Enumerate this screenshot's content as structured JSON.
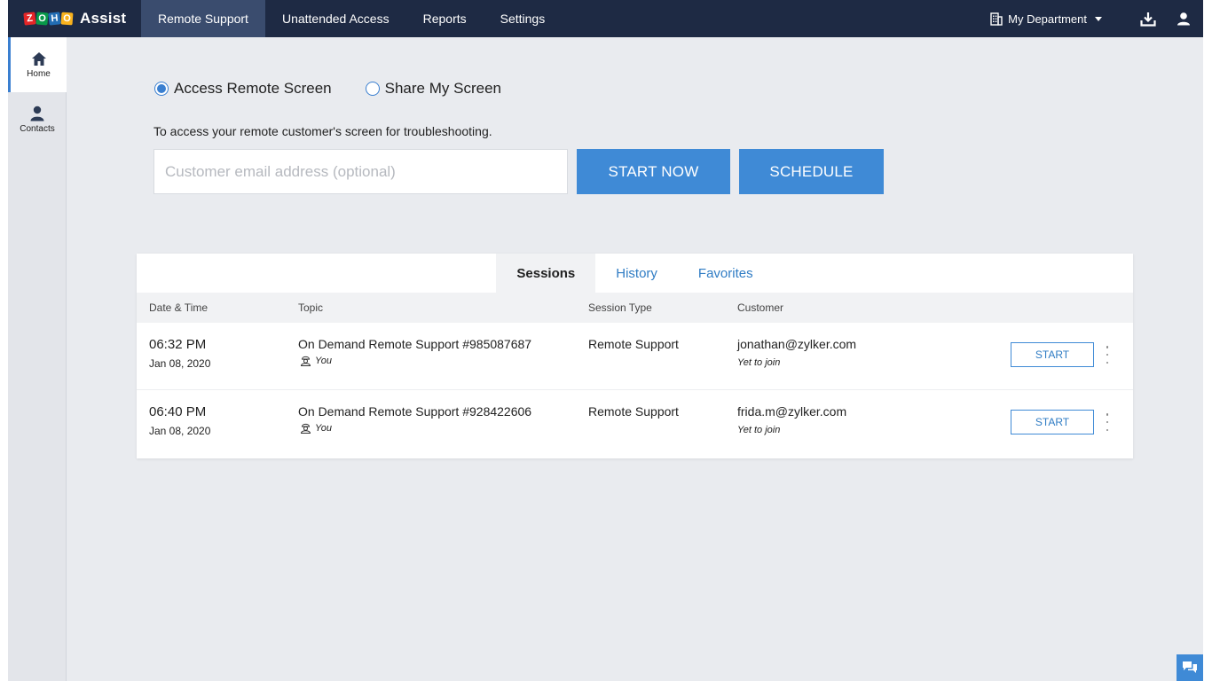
{
  "header": {
    "logo_letters": [
      "Z",
      "O",
      "H",
      "O"
    ],
    "logo_colors": [
      "#e42527",
      "#089949",
      "#226db4",
      "#f9b21d"
    ],
    "app_name": "Assist",
    "nav": [
      {
        "label": "Remote Support",
        "active": true
      },
      {
        "label": "Unattended Access",
        "active": false
      },
      {
        "label": "Reports",
        "active": false
      },
      {
        "label": "Settings",
        "active": false
      }
    ],
    "department": "My Department",
    "icons": [
      "building-icon",
      "download-icon",
      "user-icon"
    ]
  },
  "sidebar": {
    "items": [
      {
        "label": "Home",
        "icon": "home-icon",
        "active": true
      },
      {
        "label": "Contacts",
        "icon": "contacts-icon",
        "active": false
      }
    ]
  },
  "main": {
    "mode_options": [
      {
        "label": "Access Remote Screen",
        "selected": true
      },
      {
        "label": "Share My Screen",
        "selected": false
      }
    ],
    "description": "To access your remote customer's screen for troubleshooting.",
    "email_placeholder": "Customer email address (optional)",
    "email_value": "",
    "start_now_label": "START NOW",
    "schedule_label": "SCHEDULE"
  },
  "sessions": {
    "tabs": [
      {
        "label": "Sessions",
        "active": true
      },
      {
        "label": "History",
        "active": false
      },
      {
        "label": "Favorites",
        "active": false
      }
    ],
    "columns": [
      "Date & Time",
      "Topic",
      "Session Type",
      "Customer"
    ],
    "rows": [
      {
        "time": "06:32 PM",
        "date": "Jan 08, 2020",
        "topic": "On Demand Remote Support #985087687",
        "owner": "You",
        "session_type": "Remote Support",
        "customer": "jonathan@zylker.com",
        "status": "Yet to join",
        "action_label": "START"
      },
      {
        "time": "06:40 PM",
        "date": "Jan 08, 2020",
        "topic": "On Demand Remote Support #928422606",
        "owner": "You",
        "session_type": "Remote Support",
        "customer": "frida.m@zylker.com",
        "status": "Yet to join",
        "action_label": "START"
      }
    ]
  },
  "colors": {
    "topbar": "#1e2a44",
    "topbar_active": "#3a4c6e",
    "accent": "#3f8ad6",
    "link": "#2f7cc4",
    "background": "#e9ebef"
  }
}
